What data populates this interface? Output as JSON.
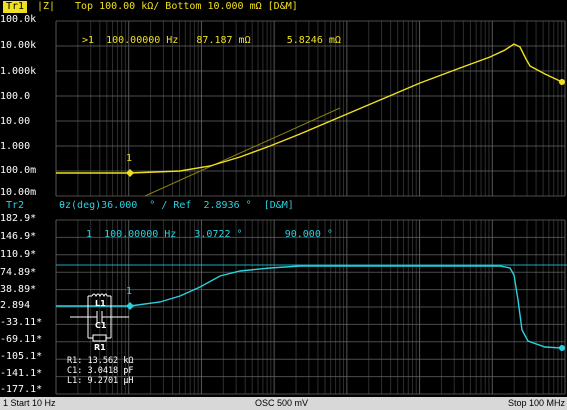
{
  "trace1": {
    "tag": "Tr1",
    "format": "|Z|",
    "scale_text": "Top 100.00 kΩ/ Bottom 10.000 mΩ [D&M]",
    "marker_readout": {
      "id": ">1",
      "freq": "100.00000 Hz",
      "val1": "87.187 mΩ",
      "val2": "5.8246 mΩ"
    },
    "y_labels": [
      "100.0k",
      "10.00k",
      "1.000k",
      "100.0",
      "10.00",
      "1.000",
      "100.0m",
      "10.00m"
    ],
    "marker_label": "1"
  },
  "trace2": {
    "tag": "Tr2",
    "scale_text": "θz(deg)36.000  ° / Ref  2.8936 °  [D&M]",
    "marker_readout": {
      "id": "1",
      "freq": "100.00000 Hz",
      "val1": "3.0722 °",
      "val2": "90.000 °"
    },
    "y_labels": [
      "182.9*",
      "146.9*",
      "110.9*",
      "74.89*",
      "38.89*",
      "2.894",
      "-33.11*",
      "-69.11*",
      "-105.1*",
      "-141.1*",
      "-177.1*"
    ],
    "marker_label": "1"
  },
  "equivalent_circuit": {
    "labels": [
      "L1",
      "C1",
      "R1"
    ],
    "values": [
      "R1: 13.562 kΩ",
      "C1: 3.0418 pF",
      "L1: 9.2701 µH"
    ]
  },
  "status": {
    "start": "1  Start 10 Hz",
    "osc": "OSC 500 mV",
    "stop": "Stop 100 MHz"
  },
  "colors": {
    "trace1": "#f0e020",
    "trace2": "#2ad0e0",
    "header_tag_bg": "#f0e020",
    "grid": "#555555"
  }
}
